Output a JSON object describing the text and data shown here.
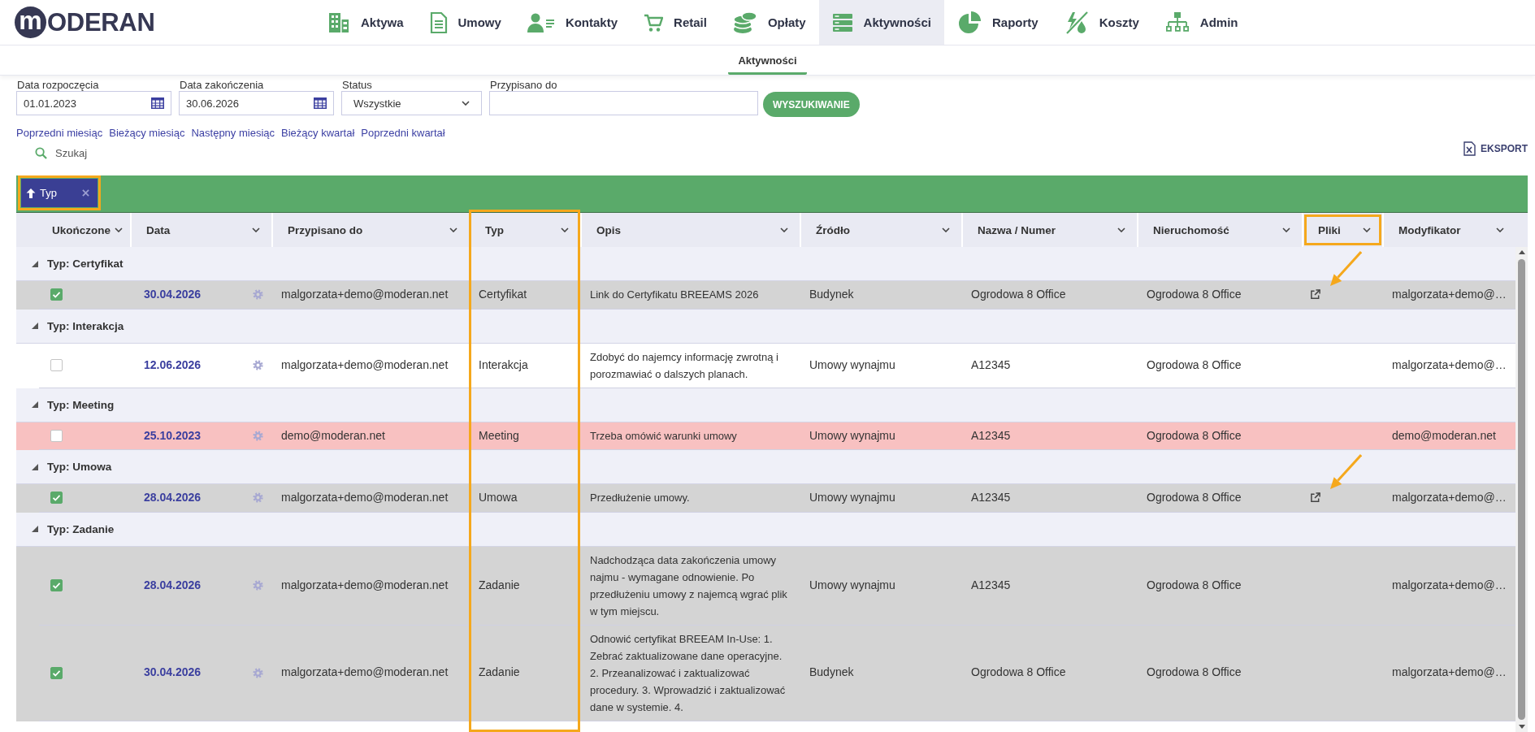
{
  "logo": {
    "mark": "m",
    "text": "ODERAN"
  },
  "nav": [
    {
      "label": "Aktywa",
      "selected": false
    },
    {
      "label": "Umowy",
      "selected": false
    },
    {
      "label": "Kontakty",
      "selected": false
    },
    {
      "label": "Retail",
      "selected": false
    },
    {
      "label": "Opłaty",
      "selected": false
    },
    {
      "label": "Aktywności",
      "selected": true
    },
    {
      "label": "Raporty",
      "selected": false
    },
    {
      "label": "Koszty",
      "selected": false
    },
    {
      "label": "Admin",
      "selected": false
    }
  ],
  "subnav": [
    {
      "label": "Aktywności",
      "selected": true
    }
  ],
  "filters": {
    "fields": [
      {
        "kind": "date",
        "label": "Data rozpoczęcia",
        "value": "01.01.2023"
      },
      {
        "kind": "date",
        "label": "Data zakończenia",
        "value": "30.06.2026"
      },
      {
        "kind": "select",
        "label": "Status",
        "value": "Wszystkie"
      },
      {
        "kind": "text",
        "label": "Przypisano do"
      }
    ],
    "search_button": "WYSZUKIWANIE"
  },
  "quick_links": [
    "Poprzedni miesiąc",
    "Bieżący miesiąc",
    "Następny miesiąc",
    "Bieżący kwartał",
    "Poprzedni kwartał"
  ],
  "search_link": "Szukaj",
  "export_button": "EKSPORT",
  "group_bar": {
    "chips": [
      {
        "label": "Typ",
        "ascending": true,
        "highlighted": true
      }
    ]
  },
  "table": {
    "columns": [
      {
        "label": "Ukończone"
      },
      {
        "label": "Data"
      },
      {
        "label": "Przypisano do"
      },
      {
        "label": "Typ",
        "column_highlighted": true
      },
      {
        "label": "Opis"
      },
      {
        "label": "Źródło"
      },
      {
        "label": "Nazwa / Numer"
      },
      {
        "label": "Nieruchomość"
      },
      {
        "label": "Pliki",
        "header_highlighted": true
      },
      {
        "label": "Modyfikator"
      }
    ],
    "groups": [
      {
        "label": "Typ: Certyfikat",
        "expanded": true,
        "rows": [
          {
            "checked": true,
            "overdue": false,
            "date": "30.04.2026",
            "assigned_to": "malgorzata+demo@moderan.net",
            "type": "Certyfikat",
            "description": "Link do Certyfikatu BREEAMS 2026",
            "source": "Budynek",
            "name_number": "Ogrodowa 8 Office",
            "property": "Ogrodowa 8 Office",
            "file_link": true,
            "arrow": true,
            "modifier": "malgorzata+demo@…"
          }
        ]
      },
      {
        "label": "Typ: Interakcja",
        "expanded": true,
        "rows": [
          {
            "checked": false,
            "overdue": false,
            "date": "12.06.2026",
            "assigned_to": "malgorzata+demo@moderan.net",
            "type": "Interakcja",
            "description": "Zdobyć do najemcy informację zwrotną i porozmawiać o dalszych planach.",
            "source": "Umowy wynajmu",
            "name_number": "A12345",
            "property": "Ogrodowa 8 Office",
            "file_link": false,
            "arrow": false,
            "modifier": "malgorzata+demo@…"
          }
        ]
      },
      {
        "label": "Typ: Meeting",
        "expanded": true,
        "rows": [
          {
            "checked": false,
            "overdue": true,
            "date": "25.10.2023",
            "assigned_to": "demo@moderan.net",
            "type": "Meeting",
            "description": "Trzeba omówić warunki umowy",
            "source": "Umowy wynajmu",
            "name_number": "A12345",
            "property": "Ogrodowa 8 Office",
            "file_link": false,
            "arrow": false,
            "modifier": "demo@moderan.net"
          }
        ]
      },
      {
        "label": "Typ: Umowa",
        "expanded": true,
        "rows": [
          {
            "checked": true,
            "overdue": false,
            "date": "28.04.2026",
            "assigned_to": "malgorzata+demo@moderan.net",
            "type": "Umowa",
            "description": "Przedłużenie umowy.",
            "source": "Umowy wynajmu",
            "name_number": "A12345",
            "property": "Ogrodowa 8 Office",
            "file_link": true,
            "arrow": true,
            "modifier": "malgorzata+demo@…"
          }
        ]
      },
      {
        "label": "Typ: Zadanie",
        "expanded": true,
        "rows": [
          {
            "checked": true,
            "overdue": false,
            "date": "28.04.2026",
            "assigned_to": "malgorzata+demo@moderan.net",
            "type": "Zadanie",
            "description": "Nadchodząca data zakończenia umowy najmu - wymagane odnowienie. Po przedłużeniu umowy z najemcą wgrać plik w tym miejscu.",
            "source": "Umowy wynajmu",
            "name_number": "A12345",
            "property": "Ogrodowa 8 Office",
            "file_link": false,
            "arrow": false,
            "modifier": "malgorzata+demo@…"
          },
          {
            "checked": true,
            "overdue": false,
            "date": "30.04.2026",
            "assigned_to": "malgorzata+demo@moderan.net",
            "type": "Zadanie",
            "description": "Odnowić certyfikat BREEAM In-Use: 1. Zebrać zaktualizowane dane operacyjne. 2. Przeanalizować i zaktualizować procedury. 3. Wprowadzić i zaktualizować dane w systemie. 4.",
            "source": "Budynek",
            "name_number": "Ogrodowa 8 Office",
            "property": "Ogrodowa 8 Office",
            "file_link": false,
            "arrow": false,
            "modifier": "malgorzata+demo@…"
          }
        ]
      }
    ]
  }
}
